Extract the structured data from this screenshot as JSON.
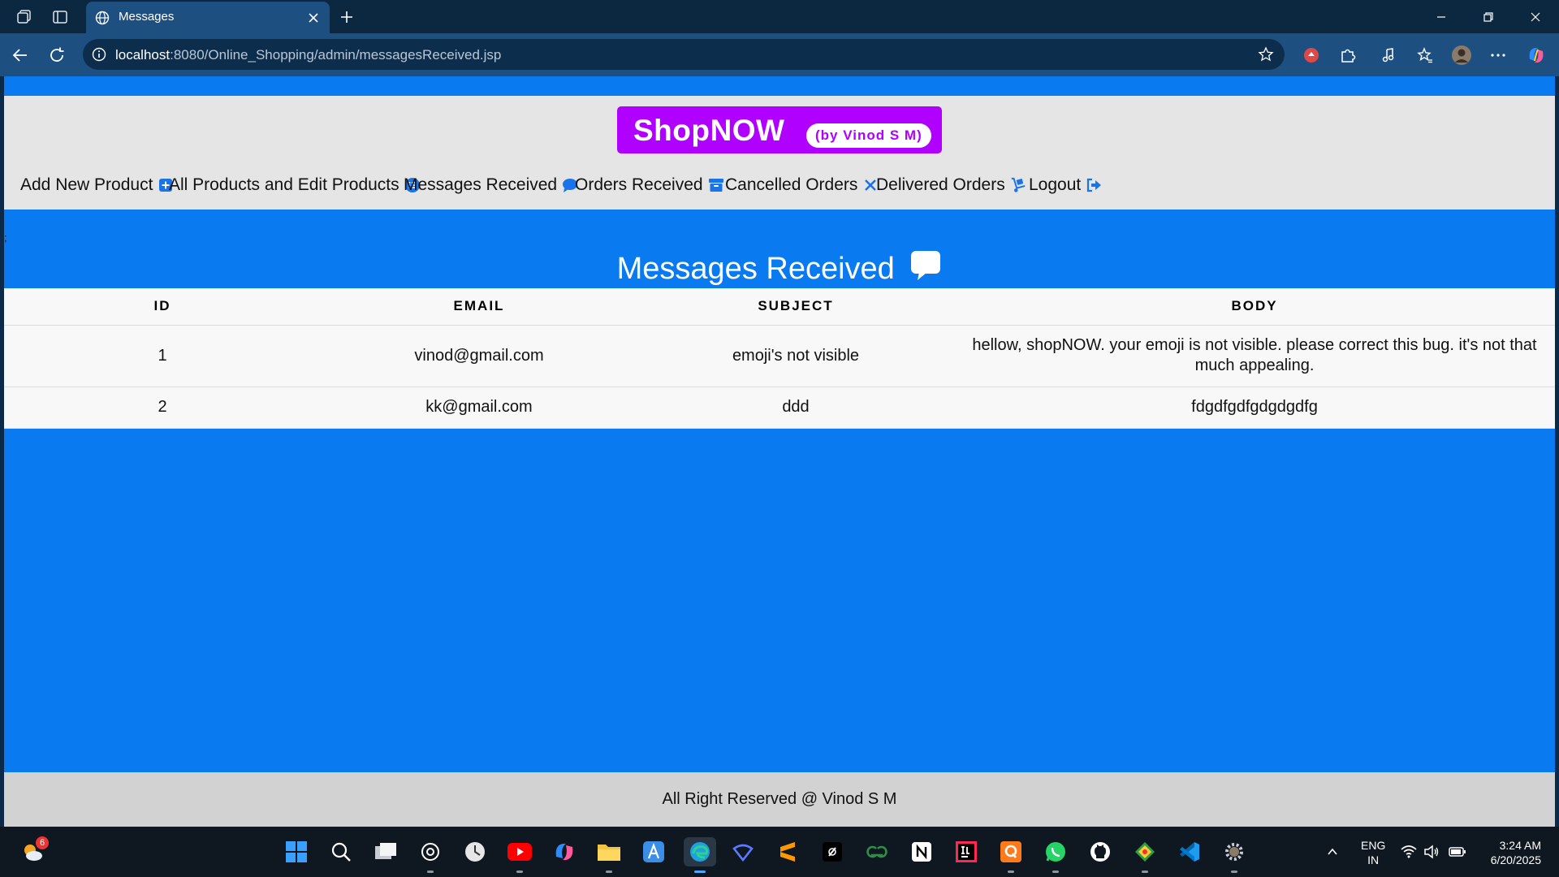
{
  "browser": {
    "tab_title": "Messages",
    "url_host": "localhost",
    "url_rest": ":8080/Online_Shopping/admin/messagesReceived.jsp"
  },
  "site": {
    "logo_main": "ShopNOW",
    "logo_sub": "(by Vinod S M)",
    "nav": [
      {
        "label": "Add New Product",
        "icon": "plus-square-icon"
      },
      {
        "label": "All Products and Edit Products",
        "icon": "list-circle-icon"
      },
      {
        "label": "Messages Received",
        "icon": "comment-icon"
      },
      {
        "label": "Orders Received",
        "icon": "archive-icon"
      },
      {
        "label": "Cancelled Orders",
        "icon": "x-icon"
      },
      {
        "label": "Delivered Orders",
        "icon": "dolly-icon"
      },
      {
        "label": "Logout",
        "icon": "sign-out-icon"
      }
    ],
    "stray_mark": ";",
    "heading": "Messages Received",
    "table": {
      "headers": [
        "ID",
        "EMAIL",
        "SUBJECT",
        "BODY"
      ],
      "rows": [
        {
          "id": "1",
          "email": "vinod@gmail.com",
          "subject": "emoji's not visible",
          "body": "hellow, shopNOW. your emoji is not visible. please correct this bug. it's not that much appealing."
        },
        {
          "id": "2",
          "email": "kk@gmail.com",
          "subject": "ddd",
          "body": "fdgdfgdfgdgdgdfg"
        }
      ]
    },
    "footer": "All Right Reserved @ Vinod S M"
  },
  "taskbar": {
    "weather_badge": "6",
    "lang_line1": "ENG",
    "lang_line2": "IN",
    "time": "3:24 AM",
    "date": "6/20/2025"
  },
  "colors": {
    "page_blue": "#0a7af0",
    "logo_purple": "#b000ff",
    "icon_blue": "#1a73e8"
  }
}
